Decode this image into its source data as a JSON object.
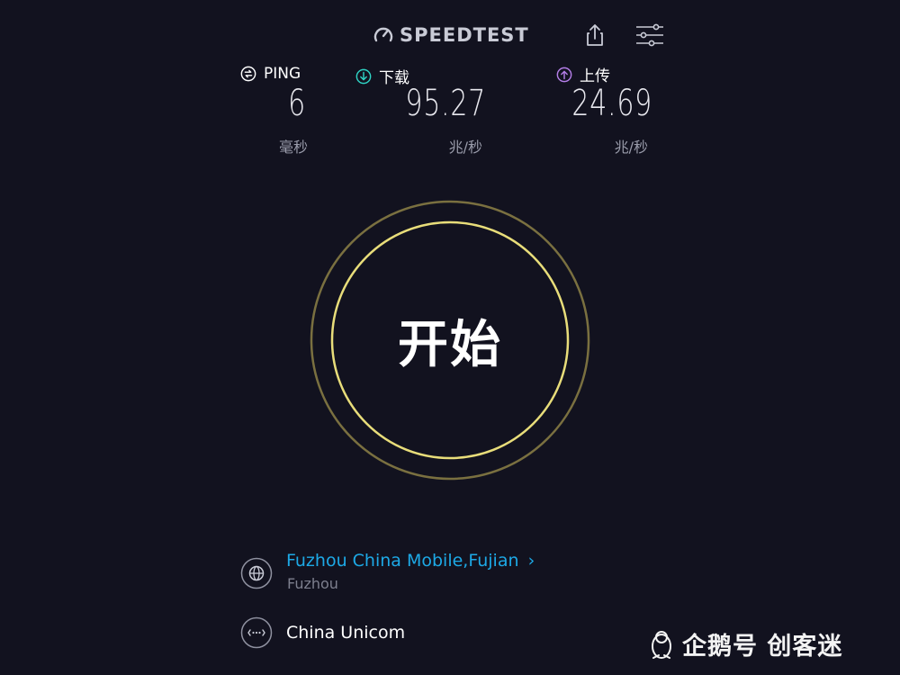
{
  "header": {
    "logo_text": "SPEEDTEST",
    "share_icon": "share-icon",
    "settings_icon": "sliders-icon"
  },
  "metrics": {
    "ping": {
      "label": "PING",
      "value": "6",
      "unit": "毫秒",
      "icon": "ping-icon",
      "color": "#ffffff"
    },
    "download": {
      "label": "下载",
      "value": "95.27",
      "unit": "兆/秒",
      "icon": "download-arrow-icon",
      "color": "#2fd3c4"
    },
    "upload": {
      "label": "上传",
      "value": "24.69",
      "unit": "兆/秒",
      "icon": "upload-arrow-icon",
      "color": "#b47ee8"
    }
  },
  "start": {
    "label": "开始",
    "ring_color": "#e8dd7a",
    "outer_ring_color": "#7a7040"
  },
  "server": {
    "name": "Fuzhou China Mobile,Fujian",
    "city": "Fuzhou",
    "icon": "globe-icon",
    "link_color": "#1da9e6"
  },
  "isp": {
    "name": "China Unicom",
    "icon": "connection-dots-icon"
  },
  "watermark": {
    "text": "企鹅号 创客迷",
    "icon": "penguin-icon"
  }
}
